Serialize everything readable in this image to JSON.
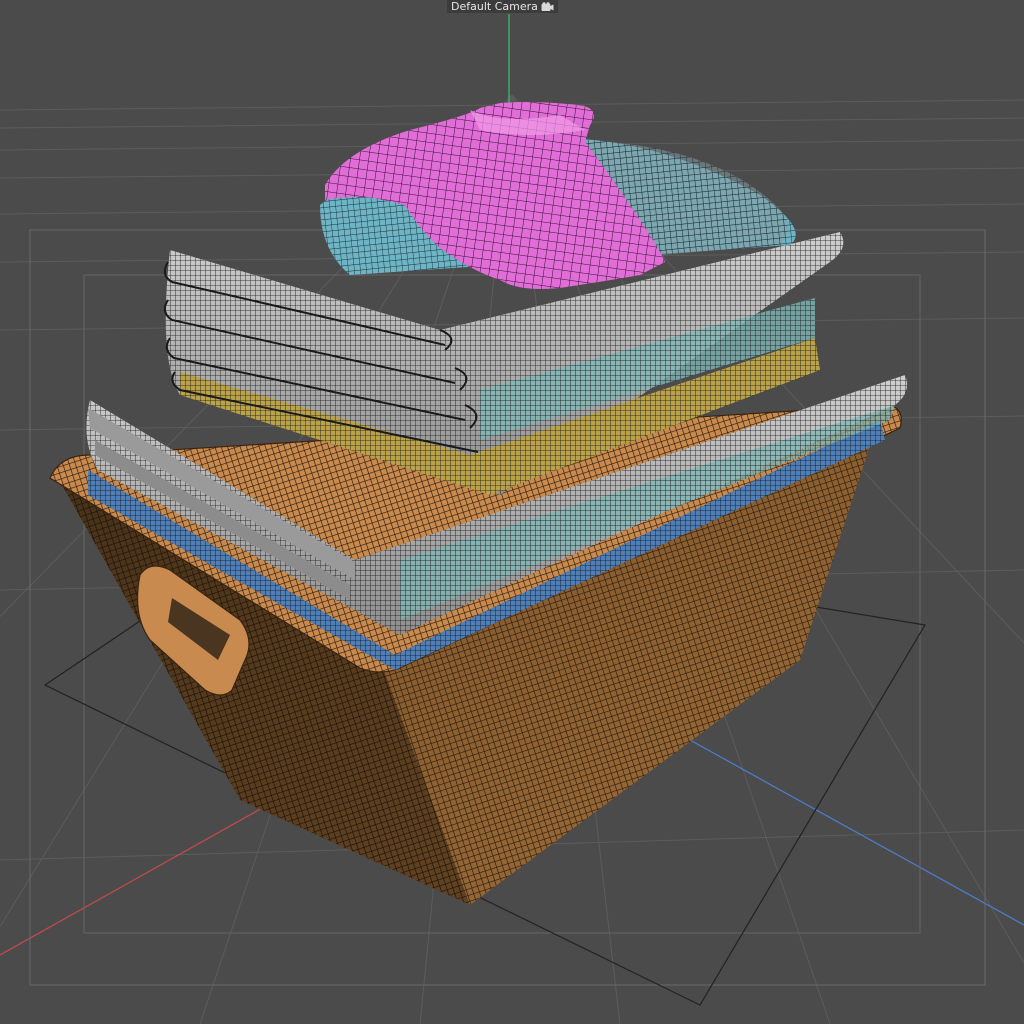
{
  "viewport": {
    "camera_name": "Default Camera",
    "camera_icon": "camera-icon",
    "view_mode": "wireframe",
    "colors": {
      "background": "#4b4b4b",
      "grid": "#5b5b5b",
      "axis_x": "#c84a4a",
      "axis_y": "#3fbf6a",
      "axis_z": "#4a7fd4",
      "basket": "#c88a4e",
      "towel_blue": "#4f7fb8",
      "towel_grey": "#b9b9b9",
      "towel_teal": "#7fb6b6",
      "towel_yellow": "#b9a24a",
      "cushion": "#6fb4c4",
      "shirt": "#e06ed6"
    }
  }
}
